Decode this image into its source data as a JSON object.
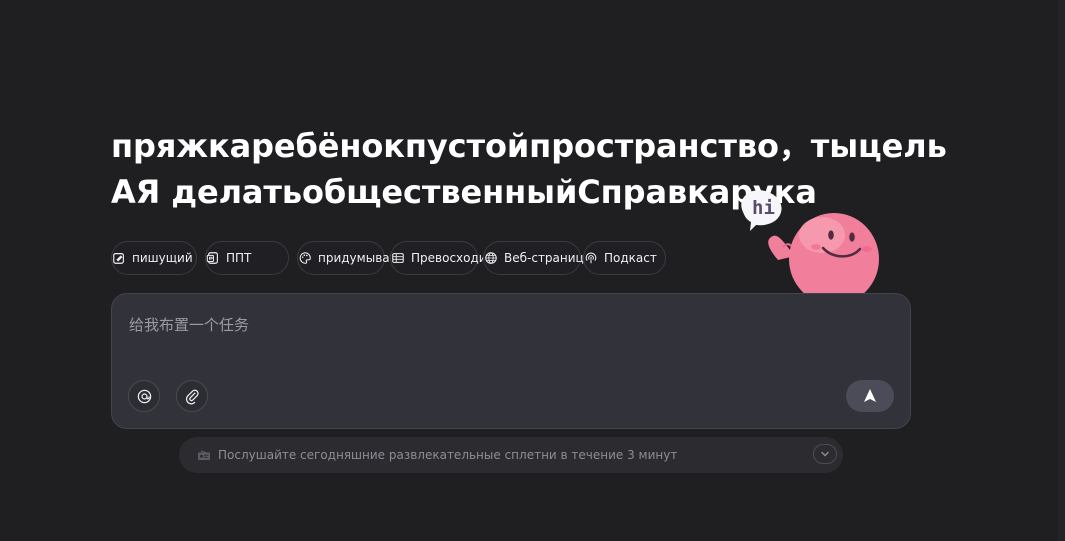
{
  "hero": {
    "title_line1": "пряжкаребёнокпустойпространство，тыцель",
    "title_line2": "АЯ делатьобщественныйСправкарука"
  },
  "chips": [
    {
      "label": "пишущий",
      "icon": "edit-icon"
    },
    {
      "label": "ППТ",
      "icon": "ppt-icon"
    },
    {
      "label": "придумывать",
      "icon": "palette-icon"
    },
    {
      "label": "Превосходить",
      "icon": "table-icon"
    },
    {
      "label": "Веб-страница",
      "icon": "globe-icon"
    },
    {
      "label": "Подкаст",
      "icon": "podcast-icon"
    }
  ],
  "composer": {
    "placeholder": "给我布置一个任务"
  },
  "suggestion": {
    "text": "Послушайте сегодняшние развлекательные сплетни в течение 3 минут",
    "icon": "radio-icon"
  },
  "mascot": {
    "speech": "hi"
  },
  "colors": {
    "background": "#1f1f22",
    "composer": "#32323b",
    "send_button": "#4c4c58",
    "mascot": "#f17f9c"
  }
}
